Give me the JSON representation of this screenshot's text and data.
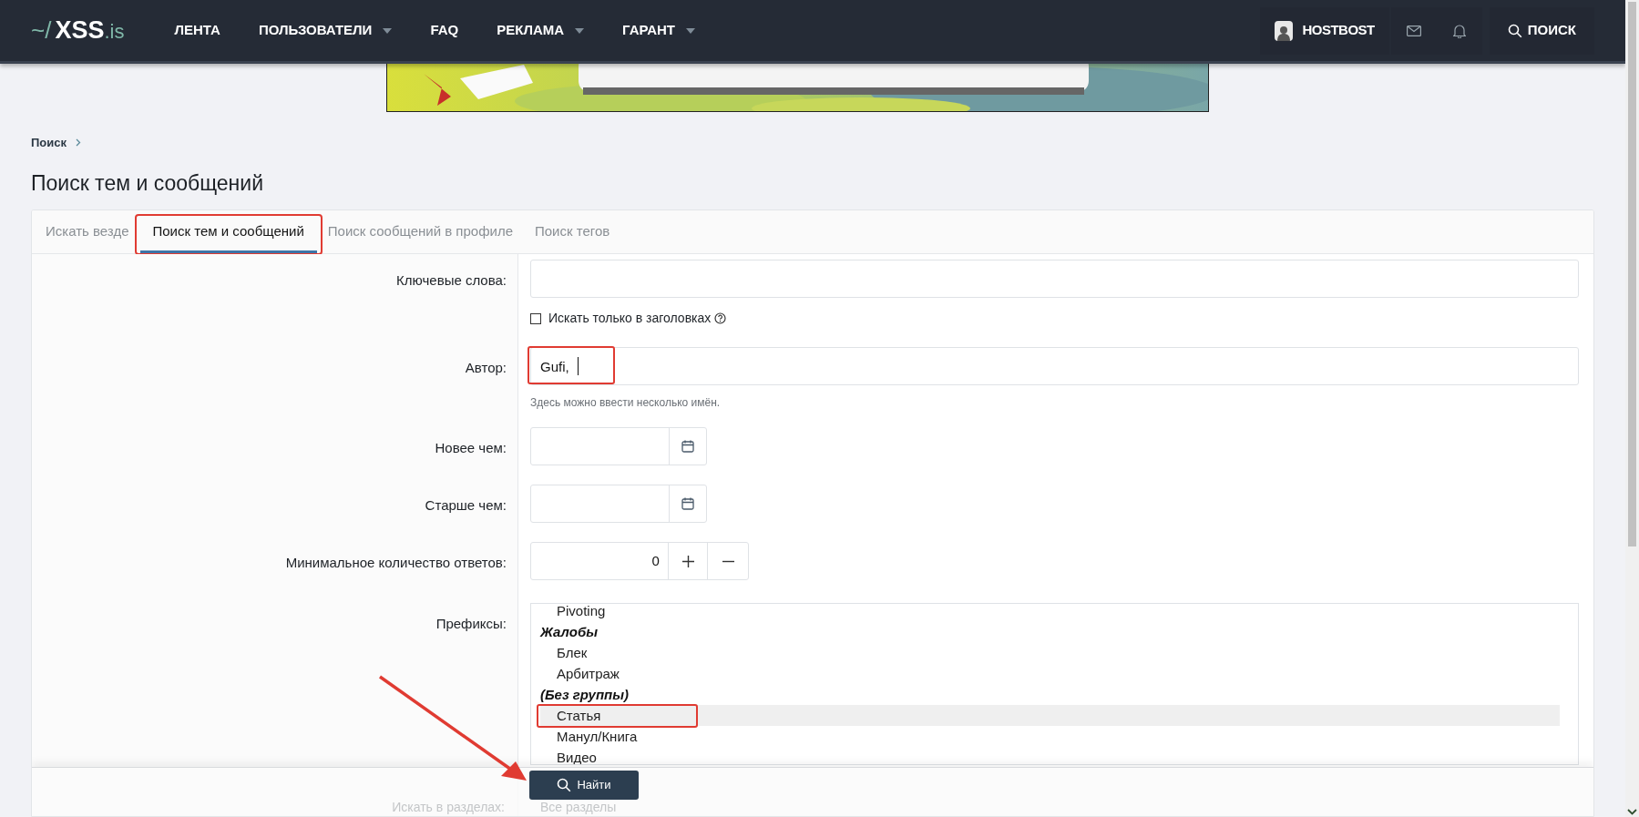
{
  "header": {
    "logo_prefix": "~/",
    "logo_main": "XSS",
    "logo_suffix": ".is",
    "nav": [
      {
        "label": "ЛЕНТА",
        "dropdown": false
      },
      {
        "label": "ПОЛЬЗОВАТЕЛИ",
        "dropdown": true
      },
      {
        "label": "FAQ",
        "dropdown": false
      },
      {
        "label": "РЕКЛАМА",
        "dropdown": true
      },
      {
        "label": "ГАРАНТ",
        "dropdown": true
      }
    ],
    "user": "HOSTBOST",
    "search": "ПОИСК"
  },
  "breadcrumb": [
    "Поиск"
  ],
  "page_title": "Поиск тем и сообщений",
  "tabs": [
    {
      "label": "Искать везде",
      "selected": false,
      "marked": false
    },
    {
      "label": "Поиск тем и сообщений",
      "selected": true,
      "marked": true
    },
    {
      "label": "Поиск сообщений в профиле",
      "selected": false,
      "marked": false
    },
    {
      "label": "Поиск тегов",
      "selected": false,
      "marked": false
    }
  ],
  "fields": [
    {
      "kind": "text",
      "label": "Ключевые слова:",
      "checkbox": {
        "label": "Искать только в заголовках",
        "checked": false
      }
    },
    {
      "kind": "text",
      "label": "Автор:",
      "value": "Gufi,",
      "marked": true,
      "hint": "Здесь можно ввести несколько имён."
    },
    {
      "kind": "date",
      "label": "Новее чем:"
    },
    {
      "kind": "date",
      "label": "Старше чем:"
    },
    {
      "kind": "number",
      "label": "Минимальное количество ответов:",
      "value": "0"
    },
    {
      "kind": "listbox",
      "label": "Префиксы:",
      "options": [
        {
          "kind": "option",
          "label": "Pivoting",
          "selected": false,
          "marked": false
        },
        {
          "kind": "group",
          "label": "Жалобы"
        },
        {
          "kind": "option",
          "label": "Блек",
          "selected": false,
          "marked": false
        },
        {
          "kind": "option",
          "label": "Арбитраж",
          "selected": false,
          "marked": false
        },
        {
          "kind": "group",
          "label": "(Без группы)"
        },
        {
          "kind": "option",
          "label": "Статья",
          "selected": true,
          "marked": true
        },
        {
          "kind": "option",
          "label": "Манул/Книга",
          "selected": false,
          "marked": false
        },
        {
          "kind": "option",
          "label": "Видео",
          "selected": false,
          "marked": false
        }
      ]
    },
    {
      "kind": "select",
      "label": "Искать в разделах:",
      "value": "Все разделы"
    }
  ],
  "submit": "Найти"
}
